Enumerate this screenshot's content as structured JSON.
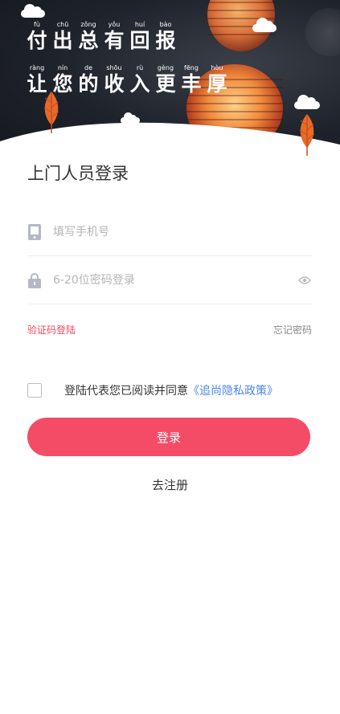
{
  "hero": {
    "line1": [
      {
        "pinyin": "fù",
        "hanzi": "付"
      },
      {
        "pinyin": "chū",
        "hanzi": "出"
      },
      {
        "pinyin": "zǒng",
        "hanzi": "总"
      },
      {
        "pinyin": "yǒu",
        "hanzi": "有"
      },
      {
        "pinyin": "huí",
        "hanzi": "回"
      },
      {
        "pinyin": "bào",
        "hanzi": "报"
      }
    ],
    "line2": [
      {
        "pinyin": "ràng",
        "hanzi": "让"
      },
      {
        "pinyin": "nín",
        "hanzi": "您"
      },
      {
        "pinyin": "de",
        "hanzi": "的"
      },
      {
        "pinyin": "shōu",
        "hanzi": "收"
      },
      {
        "pinyin": "rù",
        "hanzi": "入"
      },
      {
        "pinyin": "gèng",
        "hanzi": "更"
      },
      {
        "pinyin": "fēng",
        "hanzi": "丰"
      },
      {
        "pinyin": "hòu",
        "hanzi": "厚"
      }
    ]
  },
  "form": {
    "title": "上门人员登录",
    "phone_placeholder": "填写手机号",
    "password_placeholder": "6-20位密码登录",
    "sms_login": "验证码登陆",
    "forgot_password": "忘记密码",
    "agreement_text": "登陆代表您已阅读并同意",
    "agreement_link": "《追尚隐私政策》",
    "login_button": "登录",
    "register_link": "去注册"
  },
  "colors": {
    "accent": "#f44c67",
    "link": "#4a86e8",
    "sms_link": "#ee4a5b"
  },
  "icons": {
    "phone_icon": "phone-icon",
    "lock_icon": "lock-icon",
    "eye_icon": "eye-icon",
    "leaf_icon": "leaf-icon",
    "cloud_icon": "cloud-icon"
  }
}
